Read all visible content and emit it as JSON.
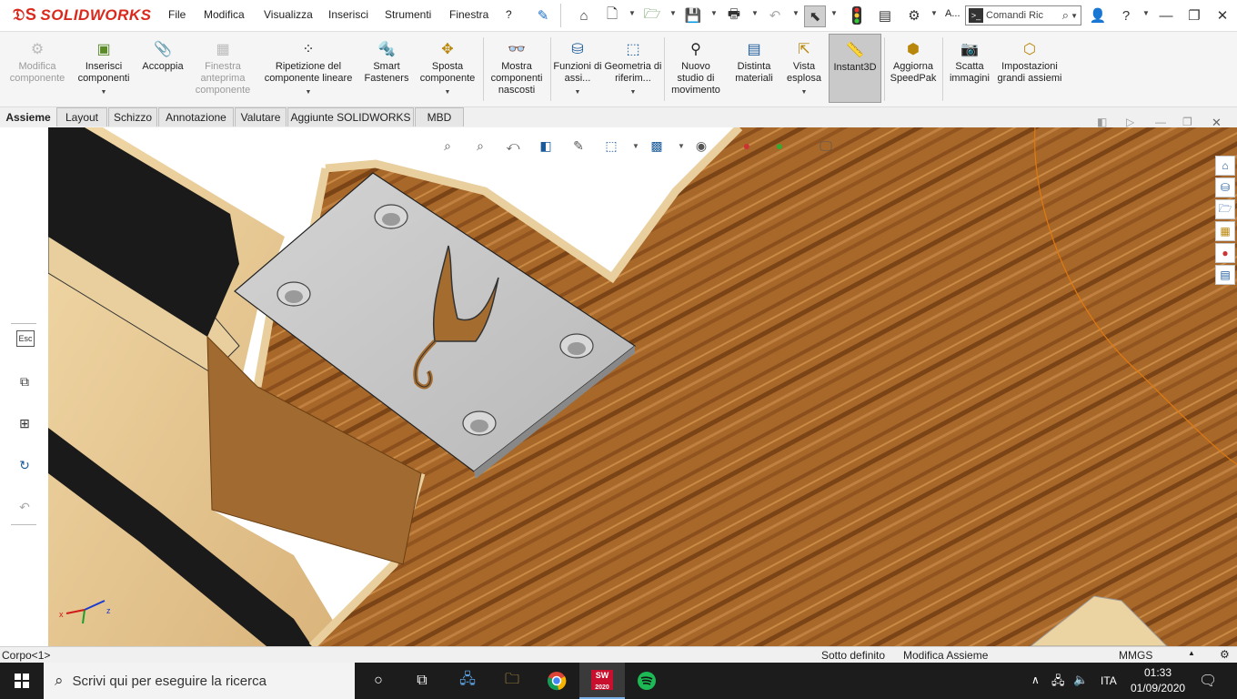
{
  "app": {
    "name": "SOLIDWORKS"
  },
  "menu": [
    "File",
    "Modifica",
    "Visualizza",
    "Inserisci",
    "Strumenti",
    "Finestra",
    "?"
  ],
  "toolbar": {
    "user_label_short": "A...",
    "search_placeholder": "Comandi Ric"
  },
  "ribbon": {
    "items": [
      {
        "label": "Modifica componente",
        "icon": "edit-component-icon",
        "enabled": false
      },
      {
        "label": "Inserisci componenti",
        "icon": "insert-components-icon",
        "enabled": true
      },
      {
        "label": "Accoppia",
        "icon": "mate-paperclip-icon",
        "enabled": true
      },
      {
        "label": "Finestra anteprima componente",
        "icon": "preview-window-icon",
        "enabled": false
      },
      {
        "label": "Ripetizione del componente lineare",
        "icon": "linear-pattern-icon",
        "enabled": true
      },
      {
        "label": "Smart Fasteners",
        "icon": "smart-fasteners-icon",
        "enabled": true
      },
      {
        "label": "Sposta componente",
        "icon": "move-component-icon",
        "enabled": true
      },
      {
        "label": "Mostra componenti nascosti",
        "icon": "show-hidden-icon",
        "enabled": true
      },
      {
        "label": "Funzioni di assi...",
        "icon": "assembly-features-icon",
        "enabled": true
      },
      {
        "label": "Geometria di riferim...",
        "icon": "reference-geometry-icon",
        "enabled": true
      },
      {
        "label": "Nuovo studio di movimento",
        "icon": "motion-study-icon",
        "enabled": true
      },
      {
        "label": "Distinta materiali",
        "icon": "bom-icon",
        "enabled": true
      },
      {
        "label": "Vista esplosa",
        "icon": "exploded-view-icon",
        "enabled": true
      },
      {
        "label": "Instant3D",
        "icon": "instant3d-icon",
        "enabled": true,
        "active": true
      },
      {
        "label": "Aggiorna SpeedPak",
        "icon": "speedpak-icon",
        "enabled": true
      },
      {
        "label": "Scatta immagini",
        "icon": "camera-icon",
        "enabled": true
      },
      {
        "label": "Impostazioni grandi assiemi",
        "icon": "large-assembly-icon",
        "enabled": true
      }
    ]
  },
  "tabs": [
    {
      "label": "Assieme",
      "active": true
    },
    {
      "label": "Layout"
    },
    {
      "label": "Schizzo"
    },
    {
      "label": "Annotazione"
    },
    {
      "label": "Valutare"
    },
    {
      "label": "Aggiunte SOLIDWORKS"
    },
    {
      "label": "MBD"
    }
  ],
  "leftpanel": {
    "esc_label": "Esc"
  },
  "statusbar": {
    "left": "Corpo<1>",
    "status": "Sotto definito",
    "mode": "Modifica Assieme",
    "units": "MMGS"
  },
  "taskbar": {
    "search_placeholder": "Scrivi qui per eseguire la ricerca",
    "lang": "ITA",
    "time": "01:33",
    "date": "01/09/2020",
    "sw_badge": "2020"
  },
  "colors": {
    "brand": "#da291c",
    "wood_light": "#e6c795",
    "wood_dark": "#a86a2c",
    "plate": "#c7c7c7"
  }
}
